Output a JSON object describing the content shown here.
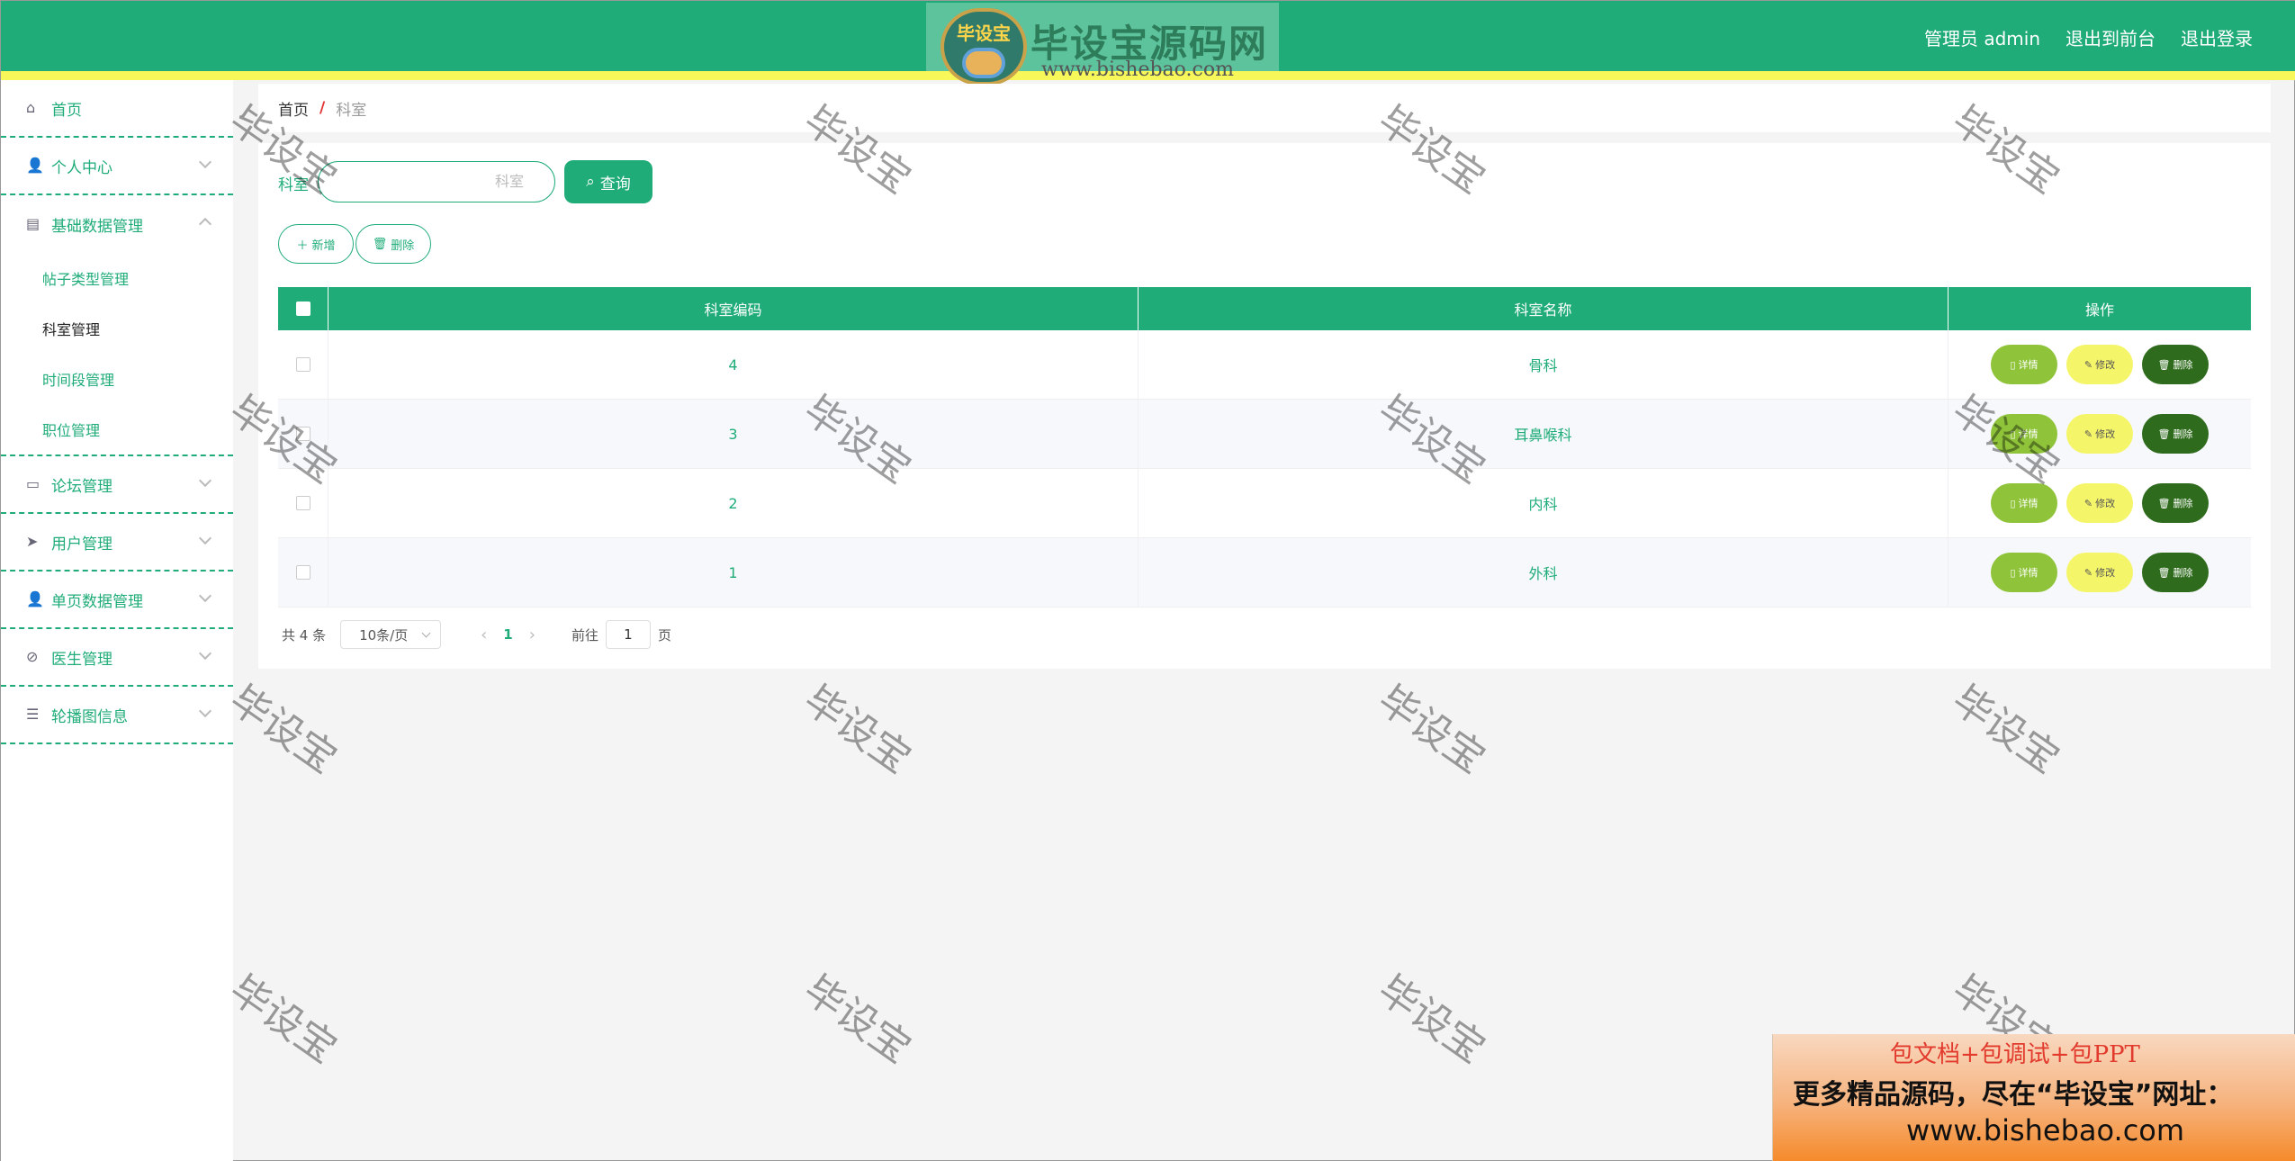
{
  "header": {
    "links": [
      "管理员 admin",
      "退出到前台",
      "退出登录"
    ]
  },
  "logo": {
    "badge": "毕设宝",
    "title": "毕设宝源码网",
    "url": "www.bishebao.com"
  },
  "sidebar": {
    "home": "首页",
    "personal": "个人中心",
    "basic_data": "基础数据管理",
    "basic_sub": [
      "帖子类型管理",
      "科室管理",
      "时间段管理",
      "职位管理"
    ],
    "forum": "论坛管理",
    "users": "用户管理",
    "single_page": "单页数据管理",
    "doctors": "医生管理",
    "carousel": "轮播图信息"
  },
  "breadcrumb": {
    "home": "首页",
    "sep": "/",
    "current": "科室"
  },
  "search": {
    "label": "科室",
    "placeholder": "科室",
    "button": "查询"
  },
  "actions": {
    "add": "新增",
    "delete": "删除"
  },
  "table": {
    "headers": [
      "科室编码",
      "科室名称",
      "操作"
    ],
    "rows": [
      {
        "code": "4",
        "name": "骨科"
      },
      {
        "code": "3",
        "name": "耳鼻喉科"
      },
      {
        "code": "2",
        "name": "内科"
      },
      {
        "code": "1",
        "name": "外科"
      }
    ],
    "ops": {
      "detail": "详情",
      "edit": "修改",
      "delete": "删除"
    }
  },
  "pagination": {
    "total": "共 4 条",
    "page_size": "10条/页",
    "current_page": "1",
    "goto_prefix": "前往",
    "goto_value": "1",
    "goto_suffix": "页"
  },
  "watermark": "毕设宝",
  "promo": {
    "line1": "包文档+包调试+包PPT",
    "line2": "更多精品源码，尽在“毕设宝”网址：",
    "line3": "www.bishebao.com"
  },
  "colors": {
    "primary": "#1fac78",
    "accent_yellow": "#f7f75a",
    "detail": "#8fc33a",
    "edit": "#f5f56a",
    "delete": "#2e6b1c"
  }
}
